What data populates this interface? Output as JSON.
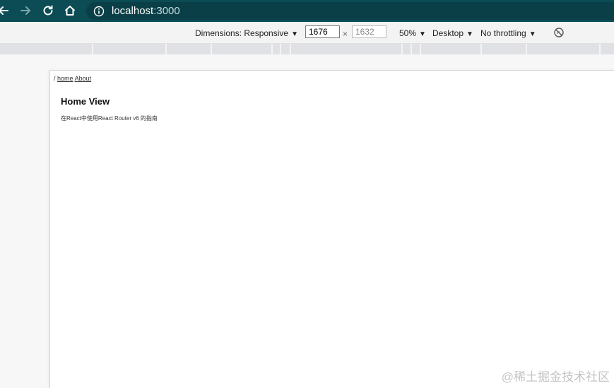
{
  "browser": {
    "url_host": "localhost",
    "url_port": ":3000"
  },
  "devtools": {
    "dimensions_label": "Dimensions: Responsive",
    "width_value": "1676",
    "height_value": "1632",
    "times_symbol": "×",
    "zoom_label": "50%",
    "device_type_label": "Desktop",
    "throttling_label": "No throttling",
    "dropdown_arrow": "▼"
  },
  "page": {
    "breadcrumb_sep": "/",
    "link_home": "home",
    "link_about": "About",
    "title": "Home View",
    "text": "在React中使用React Router v6 的指南"
  },
  "watermark": "@稀土掘金技术社区"
}
